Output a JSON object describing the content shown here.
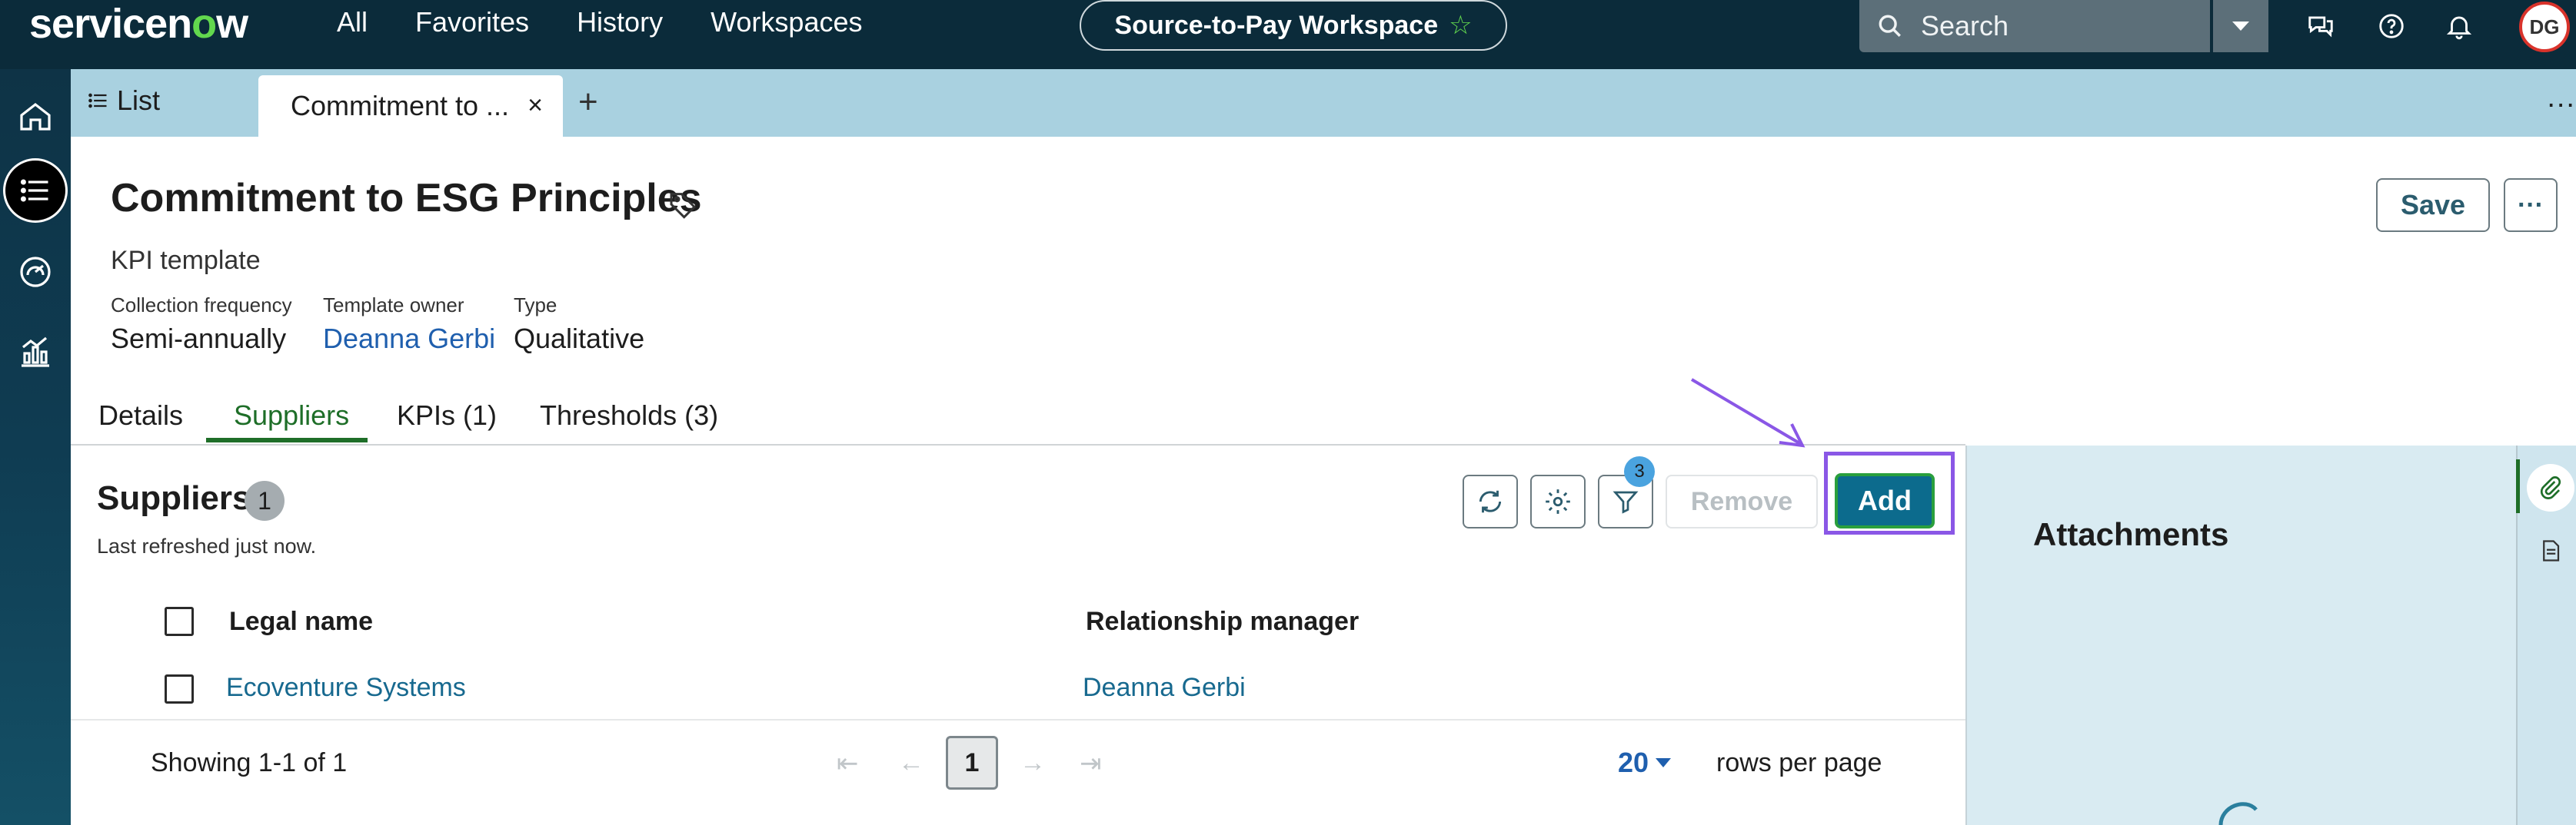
{
  "brand": {
    "logo_text_before": "servicen",
    "logo_o": "o",
    "logo_text_after": "w"
  },
  "topnav": {
    "all": "All",
    "favorites": "Favorites",
    "history": "History",
    "workspaces": "Workspaces"
  },
  "workspace": {
    "name": "Source-to-Pay Workspace"
  },
  "search": {
    "placeholder": "Search"
  },
  "user": {
    "initials": "DG"
  },
  "tabs": {
    "list_label": "List",
    "active_label": "Commitment to ...",
    "close": "×",
    "add": "+",
    "more": "..."
  },
  "record": {
    "title": "Commitment to ESG Principles",
    "subtitle": "KPI template",
    "fields": [
      {
        "label": "Collection frequency",
        "value": "Semi-annually"
      },
      {
        "label": "Template owner",
        "value": "Deanna Gerbi"
      },
      {
        "label": "Type",
        "value": "Qualitative"
      }
    ],
    "save_label": "Save",
    "more_label": "···"
  },
  "record_tabs": {
    "details": "Details",
    "suppliers": "Suppliers",
    "kpis": "KPIs (1)",
    "thresholds": "Thresholds (3)"
  },
  "suppliers": {
    "title": "Suppliers",
    "count": "1",
    "refreshed": "Last refreshed just now.",
    "filter_count": "3",
    "remove_label": "Remove",
    "add_label": "Add",
    "columns": {
      "legal_name": "Legal name",
      "relationship_manager": "Relationship manager"
    },
    "rows": [
      {
        "legal_name": "Ecoventure Systems",
        "relationship_manager": "Deanna Gerbi"
      }
    ],
    "showing": "Showing 1-1 of 1",
    "page": "1",
    "rows_per_page_value": "20",
    "rows_per_page_label": "rows per page"
  },
  "attachments": {
    "title": "Attachments"
  },
  "colors": {
    "topbar": "#0b2b3a",
    "tabstrip": "#a9d1e0",
    "accent_green": "#1e6e28",
    "add_button": "#0c6b8d",
    "focus_ring": "#8a57e6",
    "link": "#1f5fae"
  }
}
